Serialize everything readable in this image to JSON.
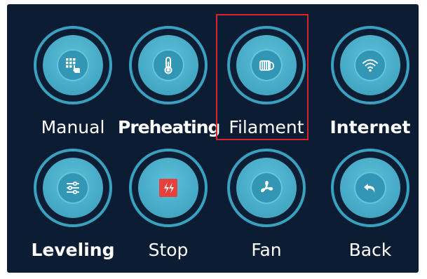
{
  "selected": "filament",
  "colors": {
    "background": "#0c1c33",
    "ring": "#3aa0bf",
    "button": "#47abc8",
    "selection": "#d9242e",
    "stop": "#e8413b"
  },
  "buttons": {
    "manual": {
      "label": "Manual",
      "icon": "keypad-hand-icon"
    },
    "preheating": {
      "label": "Preheating",
      "icon": "thermometer-icon"
    },
    "filament": {
      "label": "Filament",
      "icon": "filament-spool-icon"
    },
    "internet": {
      "label": "Internet",
      "icon": "wifi-icon"
    },
    "leveling": {
      "label": "Leveling",
      "icon": "sliders-icon"
    },
    "stop": {
      "label": "Stop",
      "icon": "stop-lightning-icon"
    },
    "fan": {
      "label": "Fan",
      "icon": "fan-icon"
    },
    "back": {
      "label": "Back",
      "icon": "back-arrow-icon"
    }
  }
}
